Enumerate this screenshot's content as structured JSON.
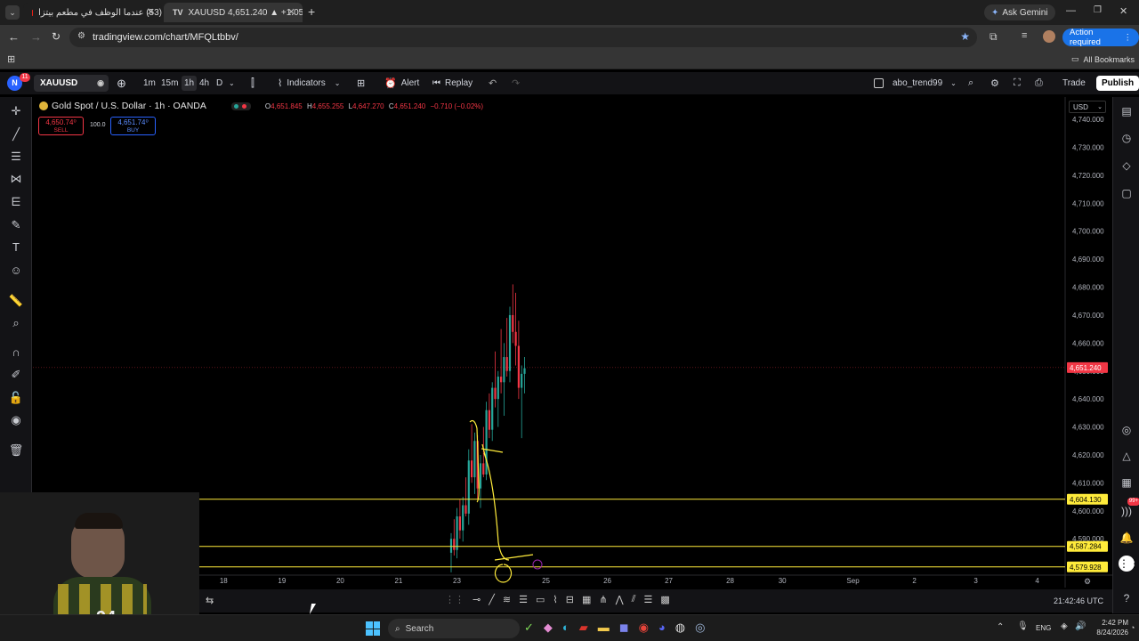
{
  "browser": {
    "tabs": [
      {
        "label": "(53) عندما الوظف في مطعم بيتزا",
        "active": false
      },
      {
        "label": "XAUUSD 4,651.240 ▲ +1.05% ...",
        "active": true
      }
    ],
    "new_tab": "+",
    "ask_gemini": "Ask Gemini",
    "url": "tradingview.com/chart/MFQLtbbv/",
    "action_required": "Action required",
    "all_bookmarks": "All Bookmarks"
  },
  "tv": {
    "avatar_letter": "N",
    "notif_count": "11",
    "symbol": "XAUUSD",
    "timeframes": [
      "1m",
      "15m",
      "1h",
      "4h",
      "D"
    ],
    "indicators": "Indicators",
    "alert": "Alert",
    "replay": "Replay",
    "layout_name": "abo_trend99",
    "trade": "Trade",
    "publish": "Publish"
  },
  "legend": {
    "title": "Gold Spot / U.S. Dollar · 1h · OANDA",
    "o_label": "O",
    "o": "4,651.845",
    "h_label": "H",
    "h": "4,655.255",
    "l_label": "L",
    "l": "4,647.270",
    "c_label": "C",
    "c": "4,651.240",
    "change": "−0.710 (−0.02%)",
    "sell_price": "4,650.74⁰",
    "sell": "SELL",
    "spread": "100.0",
    "buy_price": "4,651.74⁰",
    "buy": "BUY"
  },
  "chart_data": {
    "type": "candlestick",
    "currency": "USD",
    "y_ticks": [
      "4,740.000",
      "4,730.000",
      "4,720.000",
      "4,710.000",
      "4,700.000",
      "4,690.000",
      "4,680.000",
      "4,670.000",
      "4,660.000",
      "4,650.000",
      "4,640.000",
      "4,630.000",
      "4,620.000",
      "4,610.000",
      "4,600.000",
      "4,590.000"
    ],
    "y_tick_values": [
      4740,
      4730,
      4720,
      4710,
      4700,
      4690,
      4680,
      4670,
      4660,
      4650,
      4640,
      4630,
      4620,
      4610,
      4600,
      4590
    ],
    "ylim": [
      4577,
      4748
    ],
    "x_ticks": [
      "18",
      "19",
      "20",
      "21",
      "23",
      "25",
      "26",
      "27",
      "28",
      "30",
      "Sep",
      "2",
      "3",
      "4"
    ],
    "x_tick_slots": [
      -6.3,
      -5.35,
      -4.4,
      -3.45,
      -2.5,
      -1.05,
      -0.05,
      0.95,
      1.95,
      2.8,
      3.95,
      4.95,
      5.95,
      6.95
    ],
    "current_price": 4651.24,
    "current_price_label": "4,651.240",
    "horizontal_lines": [
      {
        "value": 4604.13,
        "label": "4,604.130"
      },
      {
        "value": 4587.284,
        "label": "4,587.284"
      },
      {
        "value": 4579.928,
        "label": "4,579.928"
      }
    ],
    "candles": [
      [
        4585,
        4592,
        4578,
        4590
      ],
      [
        4590,
        4597,
        4584,
        4586
      ],
      [
        4586,
        4601,
        4583,
        4598
      ],
      [
        4598,
        4604,
        4590,
        4593
      ],
      [
        4593,
        4605,
        4589,
        4602
      ],
      [
        4602,
        4612,
        4598,
        4599
      ],
      [
        4599,
        4622,
        4595,
        4618
      ],
      [
        4618,
        4631,
        4610,
        4612
      ],
      [
        4612,
        4628,
        4606,
        4625
      ],
      [
        4625,
        4627,
        4604,
        4608
      ],
      [
        4608,
        4620,
        4601,
        4617
      ],
      [
        4617,
        4630,
        4612,
        4613
      ],
      [
        4613,
        4639,
        4611,
        4636
      ],
      [
        4636,
        4642,
        4626,
        4629
      ],
      [
        4629,
        4646,
        4625,
        4644
      ],
      [
        4644,
        4657,
        4637,
        4640
      ],
      [
        4640,
        4650,
        4630,
        4648
      ],
      [
        4648,
        4665,
        4642,
        4646
      ],
      [
        4646,
        4660,
        4634,
        4655
      ],
      [
        4655,
        4669,
        4648,
        4650
      ],
      [
        4650,
        4673,
        4646,
        4670
      ],
      [
        4670,
        4681,
        4660,
        4664
      ],
      [
        4664,
        4678,
        4652,
        4659
      ],
      [
        4659,
        4668,
        4640,
        4644
      ],
      [
        4644,
        4652,
        4626,
        4649
      ],
      [
        4649,
        4655,
        4642,
        4651
      ]
    ]
  },
  "bottom": {
    "time": "21:42:46 UTC"
  },
  "taskbar": {
    "search": "Search",
    "lang": "ENG",
    "time": "2:42 PM",
    "date": "8/24/2026"
  }
}
